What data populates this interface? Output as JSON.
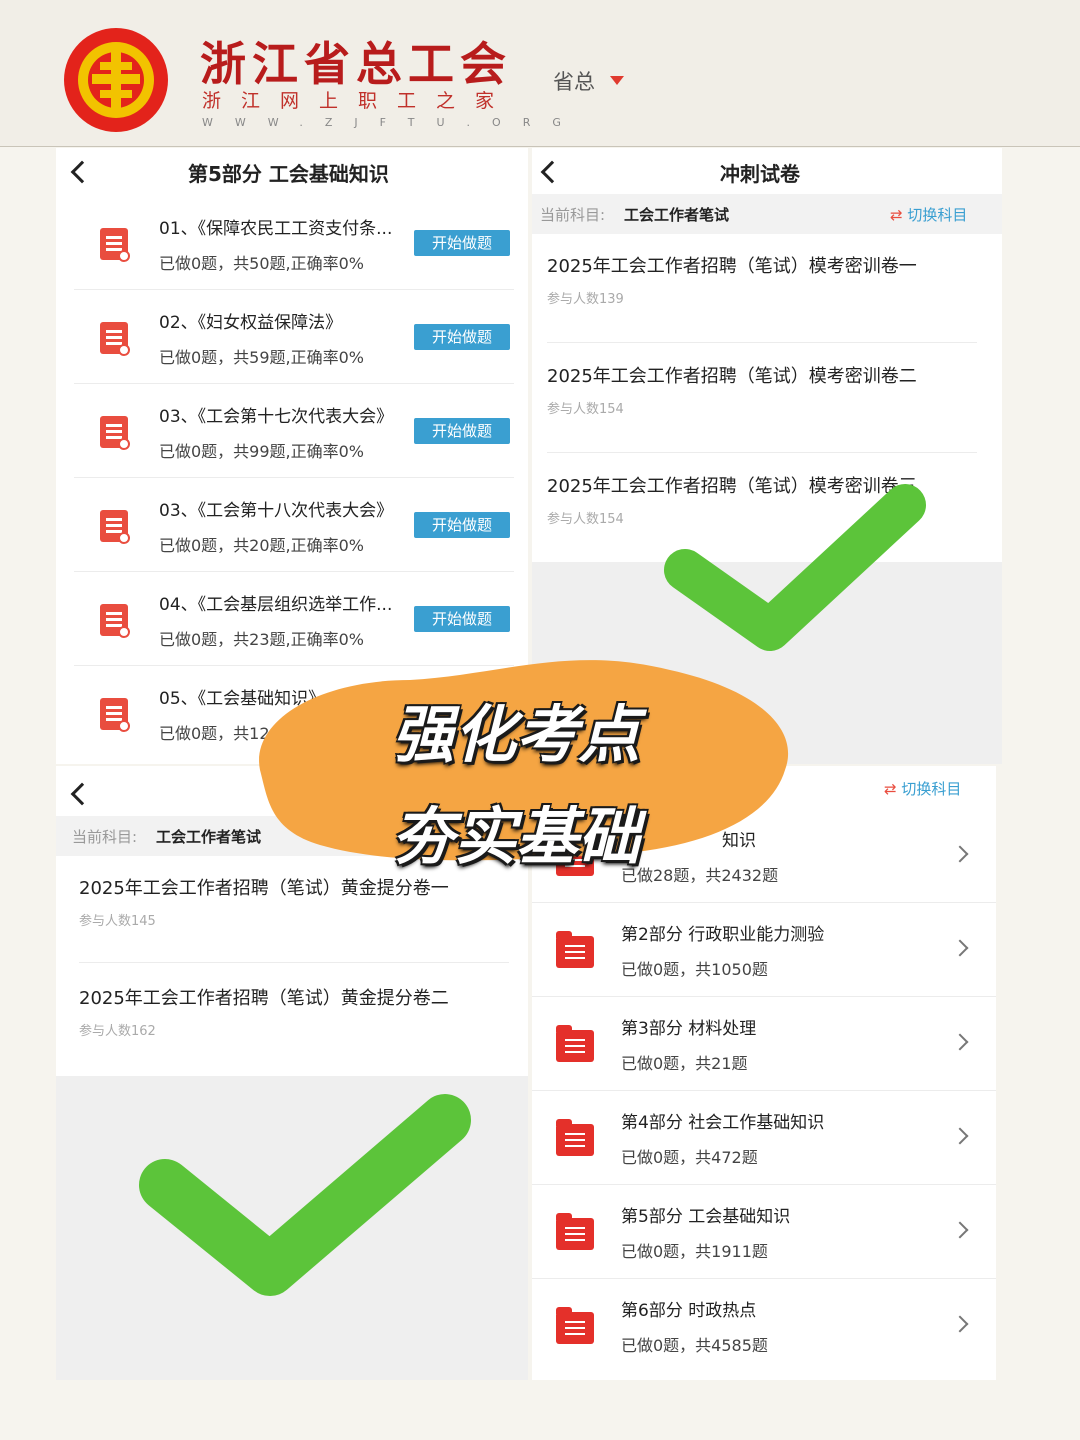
{
  "header": {
    "brand_title": "浙江省总工会",
    "brand_subtitle": "浙江网上职工之家",
    "brand_url": "WWW.ZJFTU.ORG",
    "region_label": "省总"
  },
  "panel_knowledge": {
    "title": "第5部分 工会基础知识",
    "items": [
      {
        "title": "01、《保障农民工工资支付条...",
        "meta": "已做0题，共50题,正确率0%",
        "button": "开始做题"
      },
      {
        "title": "02、《妇女权益保障法》",
        "meta": "已做0题，共59题,正确率0%",
        "button": "开始做题"
      },
      {
        "title": "03、《工会第十七次代表大会》",
        "meta": "已做0题，共99题,正确率0%",
        "button": "开始做题"
      },
      {
        "title": "03、《工会第十八次代表大会》",
        "meta": "已做0题，共20题,正确率0%",
        "button": "开始做题"
      },
      {
        "title": "04、《工会基层组织选举工作...",
        "meta": "已做0题，共23题,正确率0%",
        "button": "开始做题"
      },
      {
        "title": "05、《工会基础知识》",
        "meta": "已做0题，共12"
      }
    ]
  },
  "panel_sprint": {
    "title": "冲刺试卷",
    "subject_label": "当前科目:",
    "subject_value": "工会工作者笔试",
    "switch_label": "切换科目",
    "papers": [
      {
        "title": "2025年工会工作者招聘（笔试）模考密训卷一",
        "meta": "参与人数139"
      },
      {
        "title": "2025年工会工作者招聘（笔试）模考密训卷二",
        "meta": "参与人数154"
      },
      {
        "title": "2025年工会工作者招聘（笔试）模考密训卷三",
        "meta": "参与人数154"
      }
    ]
  },
  "panel_gold": {
    "subject_label": "当前科目:",
    "subject_value": "工会工作者笔试",
    "papers": [
      {
        "title": "2025年工会工作者招聘（笔试）黄金提分卷一",
        "meta": "参与人数145"
      },
      {
        "title": "2025年工会工作者招聘（笔试）黄金提分卷二",
        "meta": "参与人数162"
      }
    ]
  },
  "panel_parts": {
    "switch_label": "切换科目",
    "parts": [
      {
        "title": "知识",
        "meta": "已做28题，共2432题"
      },
      {
        "title": "第2部分 行政职业能力测验",
        "meta": "已做0题，共1050题"
      },
      {
        "title": "第3部分 材料处理",
        "meta": "已做0题，共21题"
      },
      {
        "title": "第4部分 社会工作基础知识",
        "meta": "已做0题，共472题"
      },
      {
        "title": "第5部分 工会基础知识",
        "meta": "已做0题，共1911题"
      },
      {
        "title": "第6部分 时政热点",
        "meta": "已做0题，共4585题"
      }
    ]
  },
  "overlay": {
    "slogan_line1": "强化考点",
    "slogan_line2": "夯实基础"
  },
  "colors": {
    "brand_red": "#b81c1c",
    "button_blue": "#3a9fd1",
    "check_green": "#5cc43a",
    "blob_orange": "#f5a543"
  }
}
